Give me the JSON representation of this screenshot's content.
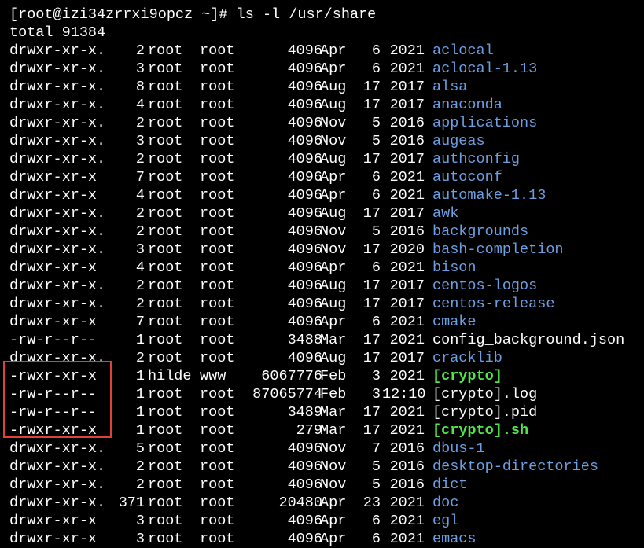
{
  "terminal": {
    "partial_top": "[",
    "prompt": "[root@izi34zrrxi9opcz ~]# ls -l /usr/share",
    "total": "total 91384",
    "colors": {
      "background": "#000000",
      "text": "#ffffff",
      "directory": "#6d9fe3",
      "executable": "#50e64a",
      "highlight_border": "#e0403a"
    },
    "entries": [
      {
        "perm": "drwxr-xr-x.",
        "links": "2",
        "owner": "root",
        "group": "root",
        "size": "4096",
        "mon": "Apr",
        "day": "6",
        "time": "2021",
        "name": "aclocal",
        "kind": "dir"
      },
      {
        "perm": "drwxr-xr-x.",
        "links": "3",
        "owner": "root",
        "group": "root",
        "size": "4096",
        "mon": "Apr",
        "day": "6",
        "time": "2021",
        "name": "aclocal-1.13",
        "kind": "dir"
      },
      {
        "perm": "drwxr-xr-x.",
        "links": "8",
        "owner": "root",
        "group": "root",
        "size": "4096",
        "mon": "Aug",
        "day": "17",
        "time": "2017",
        "name": "alsa",
        "kind": "dir"
      },
      {
        "perm": "drwxr-xr-x.",
        "links": "4",
        "owner": "root",
        "group": "root",
        "size": "4096",
        "mon": "Aug",
        "day": "17",
        "time": "2017",
        "name": "anaconda",
        "kind": "dir"
      },
      {
        "perm": "drwxr-xr-x.",
        "links": "2",
        "owner": "root",
        "group": "root",
        "size": "4096",
        "mon": "Nov",
        "day": "5",
        "time": "2016",
        "name": "applications",
        "kind": "dir"
      },
      {
        "perm": "drwxr-xr-x.",
        "links": "3",
        "owner": "root",
        "group": "root",
        "size": "4096",
        "mon": "Nov",
        "day": "5",
        "time": "2016",
        "name": "augeas",
        "kind": "dir"
      },
      {
        "perm": "drwxr-xr-x.",
        "links": "2",
        "owner": "root",
        "group": "root",
        "size": "4096",
        "mon": "Aug",
        "day": "17",
        "time": "2017",
        "name": "authconfig",
        "kind": "dir"
      },
      {
        "perm": "drwxr-xr-x",
        "links": "7",
        "owner": "root",
        "group": "root",
        "size": "4096",
        "mon": "Apr",
        "day": "6",
        "time": "2021",
        "name": "autoconf",
        "kind": "dir"
      },
      {
        "perm": "drwxr-xr-x",
        "links": "4",
        "owner": "root",
        "group": "root",
        "size": "4096",
        "mon": "Apr",
        "day": "6",
        "time": "2021",
        "name": "automake-1.13",
        "kind": "dir"
      },
      {
        "perm": "drwxr-xr-x.",
        "links": "2",
        "owner": "root",
        "group": "root",
        "size": "4096",
        "mon": "Aug",
        "day": "17",
        "time": "2017",
        "name": "awk",
        "kind": "dir"
      },
      {
        "perm": "drwxr-xr-x.",
        "links": "2",
        "owner": "root",
        "group": "root",
        "size": "4096",
        "mon": "Nov",
        "day": "5",
        "time": "2016",
        "name": "backgrounds",
        "kind": "dir"
      },
      {
        "perm": "drwxr-xr-x.",
        "links": "3",
        "owner": "root",
        "group": "root",
        "size": "4096",
        "mon": "Nov",
        "day": "17",
        "time": "2020",
        "name": "bash-completion",
        "kind": "dir"
      },
      {
        "perm": "drwxr-xr-x",
        "links": "4",
        "owner": "root",
        "group": "root",
        "size": "4096",
        "mon": "Apr",
        "day": "6",
        "time": "2021",
        "name": "bison",
        "kind": "dir"
      },
      {
        "perm": "drwxr-xr-x.",
        "links": "2",
        "owner": "root",
        "group": "root",
        "size": "4096",
        "mon": "Aug",
        "day": "17",
        "time": "2017",
        "name": "centos-logos",
        "kind": "dir"
      },
      {
        "perm": "drwxr-xr-x.",
        "links": "2",
        "owner": "root",
        "group": "root",
        "size": "4096",
        "mon": "Aug",
        "day": "17",
        "time": "2017",
        "name": "centos-release",
        "kind": "dir"
      },
      {
        "perm": "drwxr-xr-x",
        "links": "7",
        "owner": "root",
        "group": "root",
        "size": "4096",
        "mon": "Apr",
        "day": "6",
        "time": "2021",
        "name": "cmake",
        "kind": "dir"
      },
      {
        "perm": "-rw-r--r--",
        "links": "1",
        "owner": "root",
        "group": "root",
        "size": "3488",
        "mon": "Mar",
        "day": "17",
        "time": "2021",
        "name": "config_background.json",
        "kind": "file"
      },
      {
        "perm": "drwxr-xr-x.",
        "links": "2",
        "owner": "root",
        "group": "root",
        "size": "4096",
        "mon": "Aug",
        "day": "17",
        "time": "2017",
        "name": "cracklib",
        "kind": "dir"
      },
      {
        "perm": "-rwxr-xr-x",
        "links": "1",
        "owner": "hilde",
        "group": "www",
        "size": "6067776",
        "mon": "Feb",
        "day": "3",
        "time": "2021",
        "name": "[crypto]",
        "kind": "exec"
      },
      {
        "perm": "-rw-r--r--",
        "links": "1",
        "owner": "root",
        "group": "root",
        "size": "87065774",
        "mon": "Feb",
        "day": "3",
        "time": "12:10",
        "name": "[crypto].log",
        "kind": "file"
      },
      {
        "perm": "-rw-r--r--",
        "links": "1",
        "owner": "root",
        "group": "root",
        "size": "3489",
        "mon": "Mar",
        "day": "17",
        "time": "2021",
        "name": "[crypto].pid",
        "kind": "file"
      },
      {
        "perm": "-rwxr-xr-x",
        "links": "1",
        "owner": "root",
        "group": "root",
        "size": "279",
        "mon": "Mar",
        "day": "17",
        "time": "2021",
        "name": "[crypto].sh",
        "kind": "exec"
      },
      {
        "perm": "drwxr-xr-x.",
        "links": "5",
        "owner": "root",
        "group": "root",
        "size": "4096",
        "mon": "Nov",
        "day": "7",
        "time": "2016",
        "name": "dbus-1",
        "kind": "dir"
      },
      {
        "perm": "drwxr-xr-x.",
        "links": "2",
        "owner": "root",
        "group": "root",
        "size": "4096",
        "mon": "Nov",
        "day": "5",
        "time": "2016",
        "name": "desktop-directories",
        "kind": "dir"
      },
      {
        "perm": "drwxr-xr-x.",
        "links": "2",
        "owner": "root",
        "group": "root",
        "size": "4096",
        "mon": "Nov",
        "day": "5",
        "time": "2016",
        "name": "dict",
        "kind": "dir"
      },
      {
        "perm": "drwxr-xr-x.",
        "links": "371",
        "owner": "root",
        "group": "root",
        "size": "20480",
        "mon": "Apr",
        "day": "23",
        "time": "2021",
        "name": "doc",
        "kind": "dir"
      },
      {
        "perm": "drwxr-xr-x",
        "links": "3",
        "owner": "root",
        "group": "root",
        "size": "4096",
        "mon": "Apr",
        "day": "6",
        "time": "2021",
        "name": "egl",
        "kind": "dir"
      },
      {
        "perm": "drwxr-xr-x",
        "links": "3",
        "owner": "root",
        "group": "root",
        "size": "4096",
        "mon": "Apr",
        "day": "6",
        "time": "2021",
        "name": "emacs",
        "kind": "dir"
      }
    ]
  }
}
